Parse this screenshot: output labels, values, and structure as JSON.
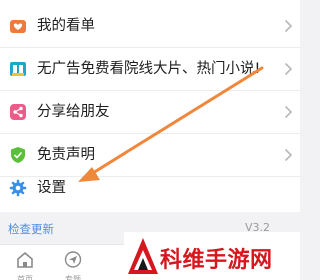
{
  "menu": {
    "items": [
      {
        "label": "我的看单",
        "icon": "heart-tv-icon",
        "color": "#f07a3a"
      },
      {
        "label": "无广告免费看院线大片、热门小说!",
        "icon": "book-icon",
        "color": "#1ea7c8"
      },
      {
        "label": "分享给朋友",
        "icon": "share-icon",
        "color": "#ec5b8a"
      },
      {
        "label": "免责声明",
        "icon": "shield-icon",
        "color": "#5cbf3a"
      },
      {
        "label": "设置",
        "icon": "gear-icon",
        "color": "#3a8fe8"
      }
    ]
  },
  "footer": {
    "check_update": "检查更新",
    "version": "V3.2"
  },
  "tabbar": {
    "tabs": [
      {
        "label": "首页",
        "icon": "home-icon"
      },
      {
        "label": "专题",
        "icon": "send-icon"
      }
    ]
  },
  "annotation": {
    "arrow_color": "#f0873a"
  },
  "watermark": {
    "text": "科维手游网",
    "color": "#d6171e"
  }
}
